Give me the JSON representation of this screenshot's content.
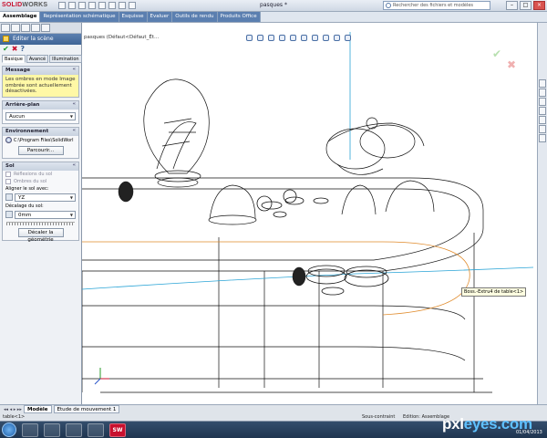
{
  "app": {
    "logo_brand": "SOLID",
    "logo_suffix": "WORKS",
    "document_title": "pasques *",
    "search_placeholder": "Rechercher des fichiers et modèles"
  },
  "ribbon_tabs": [
    {
      "label": "Assemblage",
      "active": true
    },
    {
      "label": "Représentation schématique",
      "active": false
    },
    {
      "label": "Esquisse",
      "active": false
    },
    {
      "label": "Evaluer",
      "active": false
    },
    {
      "label": "Outils de rendu",
      "active": false
    },
    {
      "label": "Produits Office",
      "active": false
    }
  ],
  "property_manager": {
    "title": "Editer la scène",
    "tabs": [
      {
        "label": "Basique",
        "active": true
      },
      {
        "label": "Avancé",
        "active": false
      },
      {
        "label": "Illumination",
        "active": false
      }
    ],
    "message": {
      "header": "Message",
      "text": "Les ombres en mode Image ombrée sont actuellement désactivées."
    },
    "background": {
      "header": "Arrière-plan",
      "value": "Aucun"
    },
    "environment": {
      "header": "Environnement",
      "path": "C:\\Program Files\\SolidWorl",
      "browse_label": "Parcourir..."
    },
    "floor": {
      "header": "Sol",
      "reflections_label": "Réflexions du sol",
      "shadows_label": "Ombres du sol",
      "align_label": "Aligner le sol avec:",
      "align_value": "YZ",
      "offset_label": "Décalage du sol:",
      "offset_value": "0mm",
      "flip_label": "Décaler la géométrie"
    }
  },
  "viewport": {
    "breadcrumb": "pasques (Défaut<Défaut_Ét...",
    "tooltip": "Boss.-Extru4 de table<1>"
  },
  "model_tabs": [
    {
      "label": "Modèle",
      "active": true
    },
    {
      "label": "Etude de mouvement 1",
      "active": false
    }
  ],
  "status_bar": {
    "left": "table<1>",
    "state": "Sous-contraint",
    "mode": "Edition: Assemblage"
  },
  "taskbar": {
    "clock": "01/04/2013",
    "watermark_a": "pxl",
    "watermark_b": "eyes.com"
  },
  "colors": {
    "brand_red": "#c8102e",
    "ribbon_blue": "#5b7fb0",
    "message_yellow": "#fff8a6"
  },
  "icons": [
    "ok-icon",
    "cancel-icon",
    "help-icon",
    "environment-globe-icon",
    "search-icon",
    "start-orb-icon",
    "triad-icon"
  ]
}
